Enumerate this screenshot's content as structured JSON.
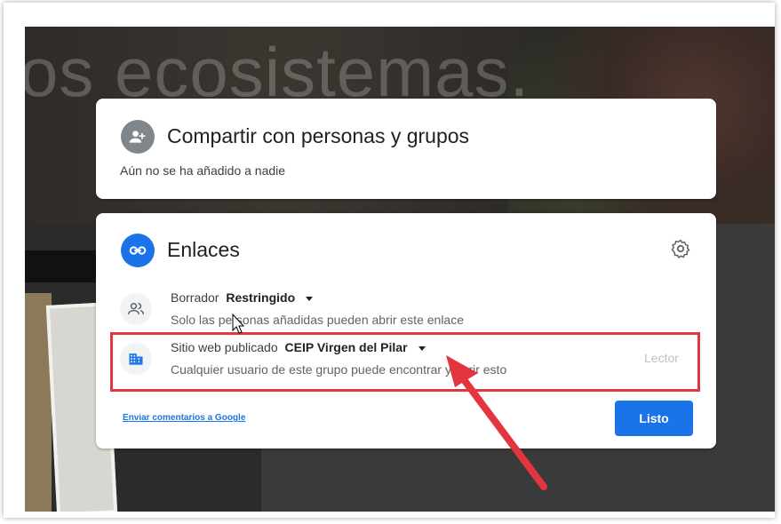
{
  "background": {
    "headline": "os ecosistemas."
  },
  "share_card": {
    "title": "Compartir con personas y grupos",
    "subtitle": "Aún no se ha añadido a nadie",
    "icon": "person-add-icon"
  },
  "links_card": {
    "title": "Enlaces",
    "icon": "link-icon",
    "settings_icon": "gear-icon",
    "rows": [
      {
        "label": "Borrador",
        "value": "Restringido",
        "description": "Solo las personas añadidas pueden abrir este enlace",
        "icon": "people-icon"
      },
      {
        "label": "Sitio web publicado",
        "value": "CEIP Virgen del Pilar",
        "description": "Cualquier usuario de este grupo puede encontrar y abrir esto",
        "role": "Lector",
        "icon": "domain-icon"
      }
    ],
    "feedback_link": "Enviar comentarios a Google",
    "done_button": "Listo"
  },
  "colors": {
    "accent": "#1a73e8",
    "annotation": "#e2353f",
    "avatar_gray": "#80868b"
  }
}
